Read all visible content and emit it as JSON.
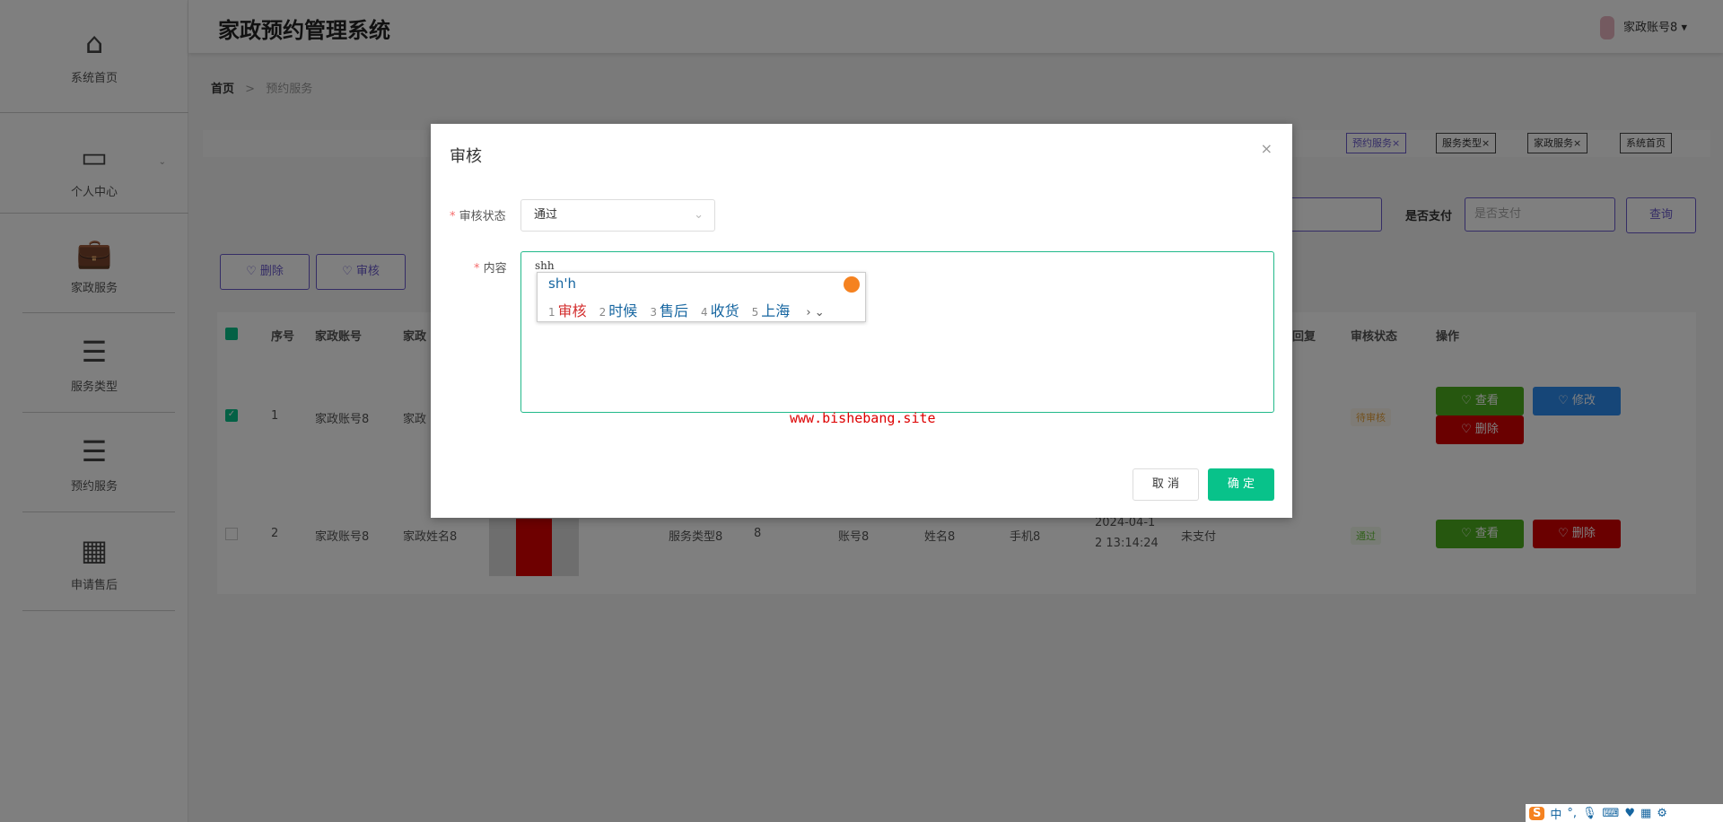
{
  "app": {
    "title": "家政预约管理系统",
    "user": "家政账号8"
  },
  "sidebar": {
    "items": [
      {
        "label": "系统首页",
        "icon": "home-icon"
      },
      {
        "label": "个人中心",
        "icon": "card-icon"
      },
      {
        "label": "家政服务",
        "icon": "briefcase-icon"
      },
      {
        "label": "服务类型",
        "icon": "list-icon"
      },
      {
        "label": "预约服务",
        "icon": "list-icon"
      },
      {
        "label": "申请售后",
        "icon": "grid-icon"
      }
    ]
  },
  "breadcrumb": {
    "home": "首页",
    "current": "预约服务"
  },
  "tags": [
    "预约服务",
    "服务类型",
    "家政服务",
    "系统首页"
  ],
  "search": {
    "label_pay": "是否支付",
    "pay_placeholder": "是否支付",
    "query": "查询"
  },
  "actions": {
    "delete": "删除",
    "audit": "审核"
  },
  "table": {
    "headers": [
      "序号",
      "家政账号",
      "家政",
      "回复",
      "审核状态",
      "操作"
    ],
    "rows": [
      {
        "no": "1",
        "account": "家政账号8",
        "name": "家政",
        "status": "待审核",
        "btns": [
          "查看",
          "修改",
          "删除"
        ]
      },
      {
        "no": "2",
        "account": "家政账号8",
        "name": "家政姓名8",
        "type": "服务类型8",
        "num": "8",
        "acc": "账号8",
        "uname": "姓名8",
        "phone": "手机8",
        "time1": "2024-04-1",
        "time2": "2 13:14:24",
        "pay": "未支付",
        "status": "通过",
        "btns": [
          "查看",
          "删除"
        ]
      }
    ]
  },
  "dialog": {
    "title": "审核",
    "status_label": "审核状态",
    "status_value": "通过",
    "content_label": "内容",
    "content_value": "shh",
    "cancel": "取 消",
    "ok": "确 定",
    "watermark": "www.bishebang.site"
  },
  "ime": {
    "composition": "sh'h",
    "candidates": [
      {
        "n": "1",
        "t": "审核"
      },
      {
        "n": "2",
        "t": "时候"
      },
      {
        "n": "3",
        "t": "售后"
      },
      {
        "n": "4",
        "t": "收货"
      },
      {
        "n": "5",
        "t": "上海"
      }
    ],
    "bar": [
      "中",
      "°,"
    ]
  },
  "colors": {
    "accent": "#22b98a",
    "primary": "#08c28a",
    "danger": "#d50000",
    "success": "#4caf1e",
    "info": "#2d8cf0"
  }
}
